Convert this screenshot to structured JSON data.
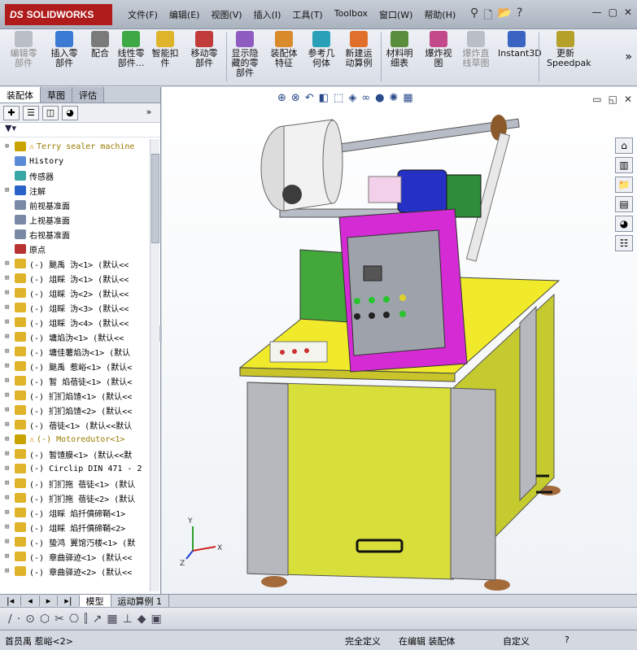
{
  "app": {
    "logo_ds": "DS",
    "logo_text": "SOLIDWORKS"
  },
  "menu": [
    "文件(F)",
    "编辑(E)",
    "视图(V)",
    "插入(I)",
    "工具(T)",
    "Toolbox",
    "窗口(W)",
    "帮助(H)"
  ],
  "ribbon": [
    {
      "label": "编辑零\n部件",
      "disabled": true,
      "color": "#b9bec7"
    },
    {
      "label": "插入零\n部件",
      "disabled": false,
      "color": "#3b7bd4"
    },
    {
      "label": "配合",
      "disabled": false,
      "color": "#7a7a7a"
    },
    {
      "label": "线性零\n部件...",
      "disabled": false,
      "color": "#3ea845"
    },
    {
      "label": "智能扣\n件",
      "disabled": false,
      "color": "#e0b42a"
    },
    {
      "label": "移动零\n部件",
      "disabled": false,
      "color": "#c13b3b"
    },
    {
      "label": "显示隐\n藏的零\n部件",
      "disabled": false,
      "color": "#8f5cc2"
    },
    {
      "label": "装配体\n特征",
      "disabled": false,
      "color": "#d98a2b"
    },
    {
      "label": "参考几\n何体",
      "disabled": false,
      "color": "#2aa0b8"
    },
    {
      "label": "新建运\n动算例",
      "disabled": false,
      "color": "#e06f2b"
    },
    {
      "label": "材料明\n细表",
      "disabled": false,
      "color": "#5a8e3c"
    },
    {
      "label": "爆炸视\n图",
      "disabled": false,
      "color": "#c24a8a"
    },
    {
      "label": "爆炸直\n线草图",
      "disabled": true,
      "color": "#b9bec7"
    },
    {
      "label": "Instant3D",
      "disabled": false,
      "color": "#3b64c2"
    },
    {
      "label": "更新\nSpeedpak",
      "disabled": false,
      "color": "#b5a12a"
    }
  ],
  "panel_tabs": [
    "装配体",
    "草图",
    "评估"
  ],
  "tree": [
    {
      "label": "Terry sealer machine",
      "warn": true,
      "color": "#c9a400",
      "exp": "⊕"
    },
    {
      "label": "History",
      "color": "#5b8ad6",
      "exp": ""
    },
    {
      "label": "传感器",
      "color": "#3aa7a7",
      "exp": ""
    },
    {
      "label": "注解",
      "color": "#2a62c9",
      "exp": "⊞"
    },
    {
      "label": "前视基准面",
      "color": "#7a8aa6",
      "exp": ""
    },
    {
      "label": "上视基准面",
      "color": "#7a8aa6",
      "exp": ""
    },
    {
      "label": "右视基准面",
      "color": "#7a8aa6",
      "exp": ""
    },
    {
      "label": "原点",
      "color": "#b83232",
      "exp": ""
    },
    {
      "label": "(-) 颫禹 沩<1> (默认<<",
      "color": "#e0b42a",
      "exp": "⊞"
    },
    {
      "label": "(-) 俎睬 沩<1> (默认<<",
      "color": "#e0b42a",
      "exp": "⊞"
    },
    {
      "label": "(-) 俎睬 沩<2> (默认<<",
      "color": "#e0b42a",
      "exp": "⊞"
    },
    {
      "label": "(-) 俎睬 沩<3> (默认<<",
      "color": "#e0b42a",
      "exp": "⊞"
    },
    {
      "label": "(-) 俎睬 沩<4> (默认<<",
      "color": "#e0b42a",
      "exp": "⊞"
    },
    {
      "label": "(-) 墉焰沩<1> (默认<<",
      "color": "#e0b42a",
      "exp": "⊞"
    },
    {
      "label": "(-) 墉佳薯焰沩<1> (默认",
      "color": "#e0b42a",
      "exp": "⊞"
    },
    {
      "label": "(-) 颫禹 惹峪<1> (默认<",
      "color": "#e0b42a",
      "exp": "⊞"
    },
    {
      "label": "(-) 暂 焰蓓徒<1> (默认<",
      "color": "#e0b42a",
      "exp": "⊞"
    },
    {
      "label": "(-) 扪扪焰馇<1> (默认<<",
      "color": "#e0b42a",
      "exp": "⊞"
    },
    {
      "label": "(-) 扪扪焰馇<2> (默认<<",
      "color": "#e0b42a",
      "exp": "⊞"
    },
    {
      "label": "(-) 蓓徒<1> (默认<<默认",
      "color": "#e0b42a",
      "exp": "⊞"
    },
    {
      "label": "(-) Motoredutor<1>",
      "warn": true,
      "color": "#c9a400",
      "exp": "⊞"
    },
    {
      "label": "(-) 暂馇膜<1> (默认<<默",
      "color": "#e0b42a",
      "exp": "⊞"
    },
    {
      "label": "(-) Circlip DIN 471 - 2",
      "color": "#e0b42a",
      "exp": "⊞"
    },
    {
      "label": "(-) 扪扪拖 蓓徒<1> (默认",
      "color": "#e0b42a",
      "exp": "⊞"
    },
    {
      "label": "(-) 扪扪拖 蓓徒<2> (默认",
      "color": "#e0b42a",
      "exp": "⊞"
    },
    {
      "label": "(-) 俎睬 焰扦僨碲鞘<1>",
      "color": "#e0b42a",
      "exp": "⊞"
    },
    {
      "label": "(-) 俎睬 焰扦僨碲鞘<2>",
      "color": "#e0b42a",
      "exp": "⊞"
    },
    {
      "label": "(-) 蛰鸿 翼馆汅楼<1> (默",
      "color": "#e0b42a",
      "exp": "⊞"
    },
    {
      "label": "(-) 章曲驿迹<1> (默认<<",
      "color": "#e0b42a",
      "exp": "⊞"
    },
    {
      "label": "(-) 章曲驿迹<2> (默认<<",
      "color": "#e0b42a",
      "exp": "⊞"
    }
  ],
  "bottom_tabs": [
    "模型",
    "运动算例 1"
  ],
  "status": {
    "left": "首员禹 惹峪<2>",
    "s1": "完全定义",
    "s2": "在编辑 装配体",
    "s3": "自定义"
  },
  "triad": {
    "x": "X",
    "y": "Y",
    "z": "Z"
  }
}
